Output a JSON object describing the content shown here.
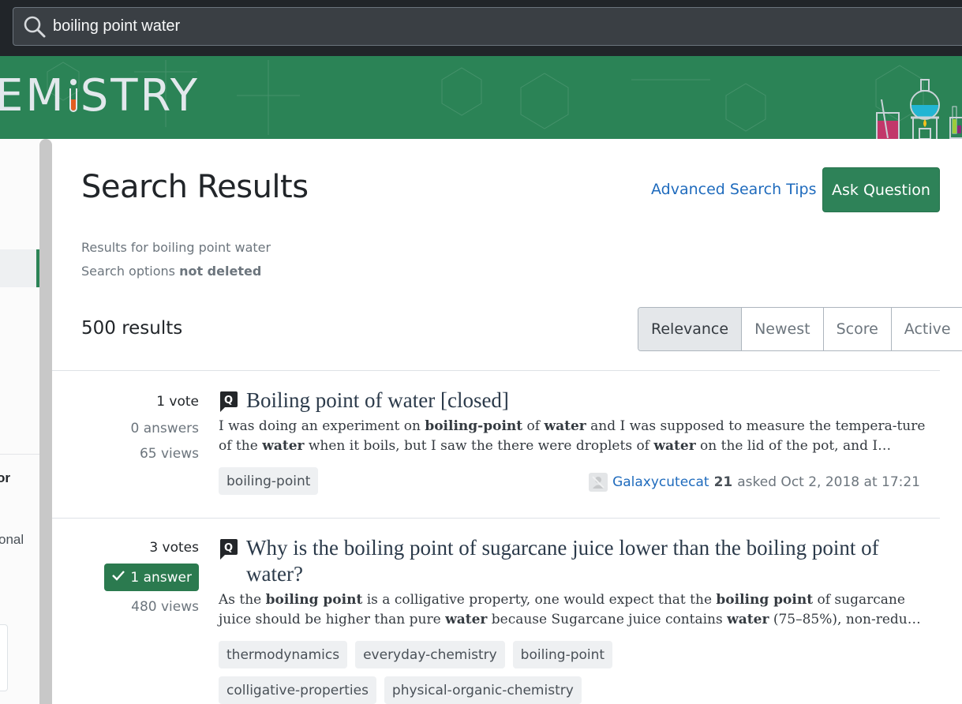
{
  "search": {
    "query": "boiling point water",
    "icon": "search-icon"
  },
  "banner": {
    "logo_prefix": "EM",
    "logo_suffix": "STRY",
    "brand_color": "#2b8356"
  },
  "sidebar": {
    "partial_text_bold": "or",
    "partial_text": "onal"
  },
  "header": {
    "title": "Search Results",
    "advanced_link": "Advanced Search Tips",
    "ask_button": "Ask Question"
  },
  "meta": {
    "results_for_label": "Results for boiling point water",
    "search_options_label": "Search options",
    "search_options_value": "not deleted"
  },
  "results_count": "500 results",
  "sort": {
    "options": [
      "Relevance",
      "Newest",
      "Score",
      "Active"
    ],
    "selected": "Relevance"
  },
  "results": [
    {
      "votes": "1 vote",
      "answers": "0 answers",
      "answered": false,
      "views": "65 views",
      "title": "Boiling point of water [closed]",
      "excerpt_html": "I was doing an experiment on <b>boiling-point</b> of <b>water</b> and I was supposed to measure the tempera-ture of the <b>water</b> when it boils, but I saw the there were droplets of <b>water</b> on the lid of the pot, and I…",
      "tags": [
        "boiling-point"
      ],
      "user": "Galaxycutecat",
      "reputation": "21",
      "asked": "asked Oct 2, 2018 at 17:21"
    },
    {
      "votes": "3 votes",
      "answers": "1 answer",
      "answered": true,
      "views": "480 views",
      "title": "Why is the boiling point of sugarcane juice lower than the boiling point of water?",
      "excerpt_html": "As the <b>boiling point</b> is a colligative property, one would expect that the <b>boiling point</b> of sugarcane juice should be higher than pure <b>water</b> because Sugarcane juice contains <b>water</b> (75–85%), non-redu…",
      "tags": [
        "thermodynamics",
        "everyday-chemistry",
        "boiling-point",
        "colligative-properties",
        "physical-organic-chemistry"
      ]
    }
  ]
}
